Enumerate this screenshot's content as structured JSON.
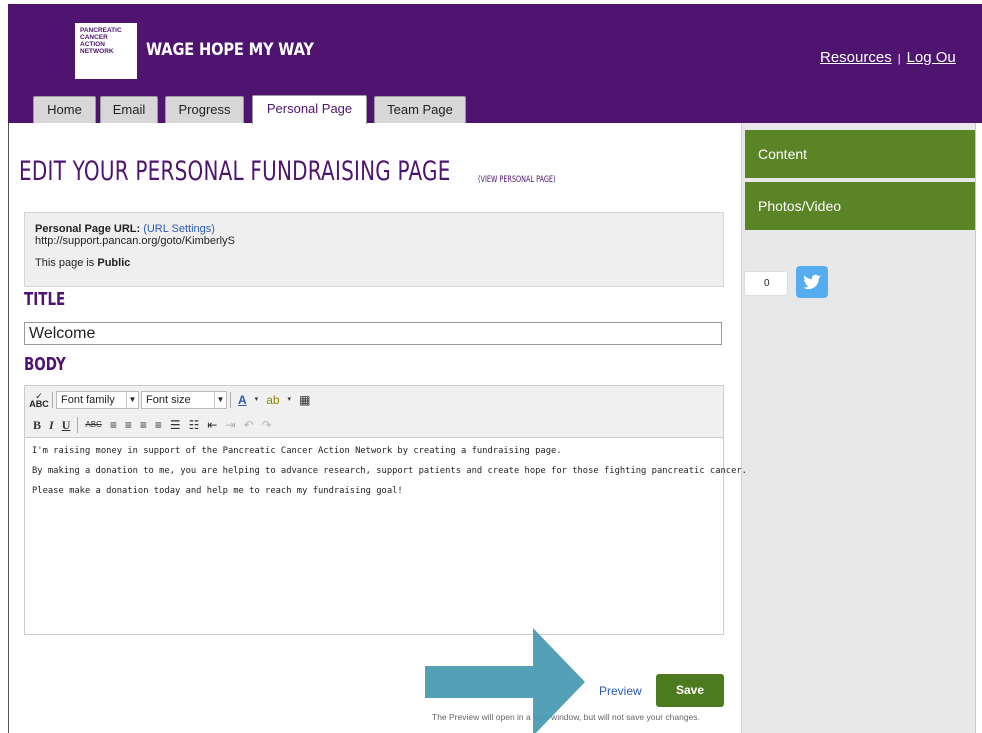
{
  "header": {
    "logo_lines": [
      "PANCREATIC",
      "CANCER",
      "ACTION",
      "NETWORK"
    ],
    "brand": "WAGE HOPE MY WAY",
    "links": {
      "resources": "Resources",
      "separator": "|",
      "logout": "Log Ou"
    }
  },
  "tabs": [
    {
      "label": "Home"
    },
    {
      "label": "Email"
    },
    {
      "label": "Progress"
    },
    {
      "label": "Personal Page",
      "active": true
    },
    {
      "label": "Team Page"
    }
  ],
  "page": {
    "title": "EDIT YOUR PERSONAL FUNDRAISING PAGE",
    "view_link": "(VIEW PERSONAL PAGE)"
  },
  "url_box": {
    "label": "Personal Page URL:",
    "settings_link": "(URL Settings)",
    "url": "http://support.pancan.org/goto/KimberlyS",
    "visibility_prefix": "This page is",
    "visibility_value": "Public"
  },
  "title_section": {
    "heading": "TITLE",
    "value": "Welcome"
  },
  "body_section": {
    "heading": "BODY"
  },
  "toolbar": {
    "spell": "ABC",
    "font_family": "Font family",
    "font_size": "Font size"
  },
  "editor": {
    "paragraphs": [
      "I'm raising money in support of the Pancreatic Cancer Action Network by creating a fundraising page.",
      "By making a donation to me, you are helping to advance research, support patients and create hope for those fighting pancreatic cancer.",
      "Please make a donation today and help me to reach my fundraising goal!"
    ]
  },
  "sidebar": {
    "items": [
      {
        "label": "Content"
      },
      {
        "label": "Photos/Video"
      }
    ],
    "share_count": "0"
  },
  "actions": {
    "preview": "Preview",
    "save": "Save",
    "note": "The Preview will open in a new window, but will not save your changes."
  },
  "colors": {
    "brand_purple": "#4e1470",
    "green": "#5b8427",
    "twitter": "#55acee",
    "arrow": "#4b9cb3"
  }
}
